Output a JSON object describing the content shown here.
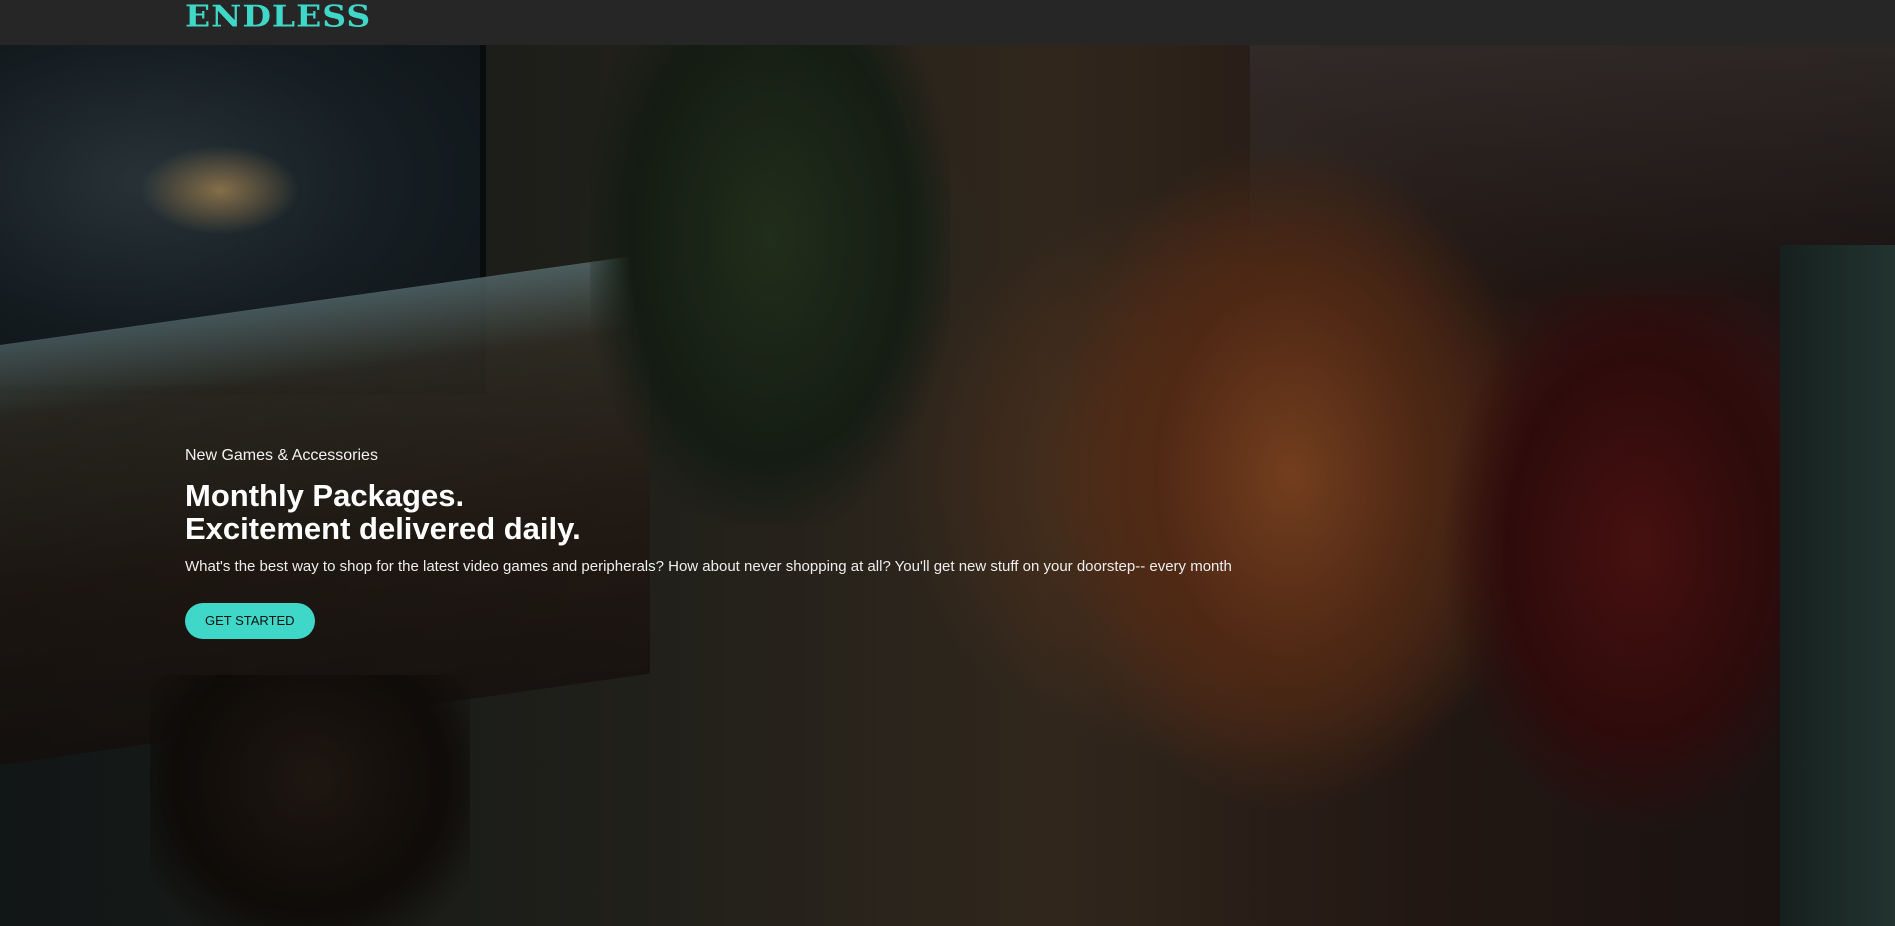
{
  "header": {
    "logo_text": "ENDLESS"
  },
  "hero": {
    "eyebrow": "New Games & Accessories",
    "headline_line1": "Monthly Packages.",
    "headline_line2": "Excitement delivered daily.",
    "description": "What's the best way to shop for the latest video games and peripherals? How about never shopping at all? You'll get new stuff on your doorstep-- every month",
    "cta_label": "GET STARTED",
    "background_image": "people-playing-video-games-photo"
  },
  "colors": {
    "accent": "#3fd8c8",
    "header_bg": "#262626",
    "text": "#ffffff"
  }
}
